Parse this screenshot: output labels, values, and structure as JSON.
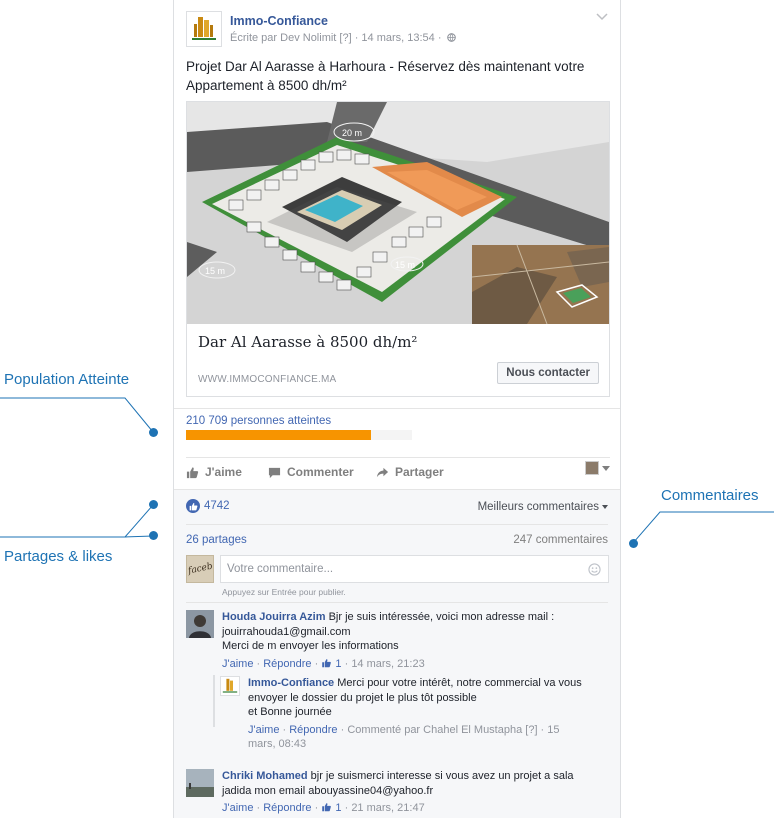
{
  "annotations": {
    "population": "Population Atteinte",
    "partages": "Partages & likes",
    "commentaires": "Commentaires"
  },
  "post": {
    "page_name": "Immo-Confiance",
    "meta": "Écrite par Dev Nolimit [?] · 14 mars, 13:54 ·",
    "text": "Projet Dar Al Aarasse à Harhoura - Réservez dès maintenant votre Appartement à 8500 dh/m²"
  },
  "preview": {
    "title": "Dar Al Aarasse à 8500 dh/m²",
    "domain": "WWW.IMMOCONFIANCE.MA",
    "button": "Nous contacter",
    "map_label_top": "20 m",
    "map_label_left": "15 m",
    "map_label_mid": "15 m"
  },
  "reach": {
    "text": "210 709 personnes atteintes",
    "fraction": 0.82
  },
  "actions": {
    "like": "J'aime",
    "comment": "Commenter",
    "share": "Partager"
  },
  "feedback": {
    "likes": "4742",
    "sort": "Meilleurs commentaires",
    "shares": "26 partages",
    "comments_count": "247 commentaires",
    "composer_placeholder": "Votre commentaire...",
    "composer_hint": "Appuyez sur Entrée pour publier.",
    "composer_avatar_text": "faceboo"
  },
  "comments": [
    {
      "author": "Houda Jouirra Azim",
      "text": "Bjr je suis intéressée, voici mon adresse mail :",
      "line2": "jouirrahouda1@gmail.com",
      "line3": "Merci de m envoyer les informations",
      "like": "J'aime",
      "reply": "Répondre",
      "likes": "1",
      "time": "14 mars, 21:23"
    },
    {
      "author": "Immo-Confiance",
      "text": "Merci pour votre intérêt, notre commercial va vous",
      "line2": "envoyer le dossier du projet le plus tôt possible",
      "line3": "et Bonne journée",
      "like": "J'aime",
      "reply": "Répondre",
      "commented_by": "Commenté par Chahel El Mustapha [?] · 15",
      "time": "mars, 08:43"
    },
    {
      "author": "Chriki Mohamed",
      "text": "bjr je suismerci interesse si vous avez un projet a sala",
      "line2": "jadida mon email abouyassine04@yahoo.fr",
      "like": "J'aime",
      "reply": "Répondre",
      "likes": "1",
      "time": "21 mars, 21:47"
    }
  ],
  "colors": {
    "accent": "#1e73b4",
    "facebook_link": "#365899",
    "reach_bar": "#f79400"
  }
}
